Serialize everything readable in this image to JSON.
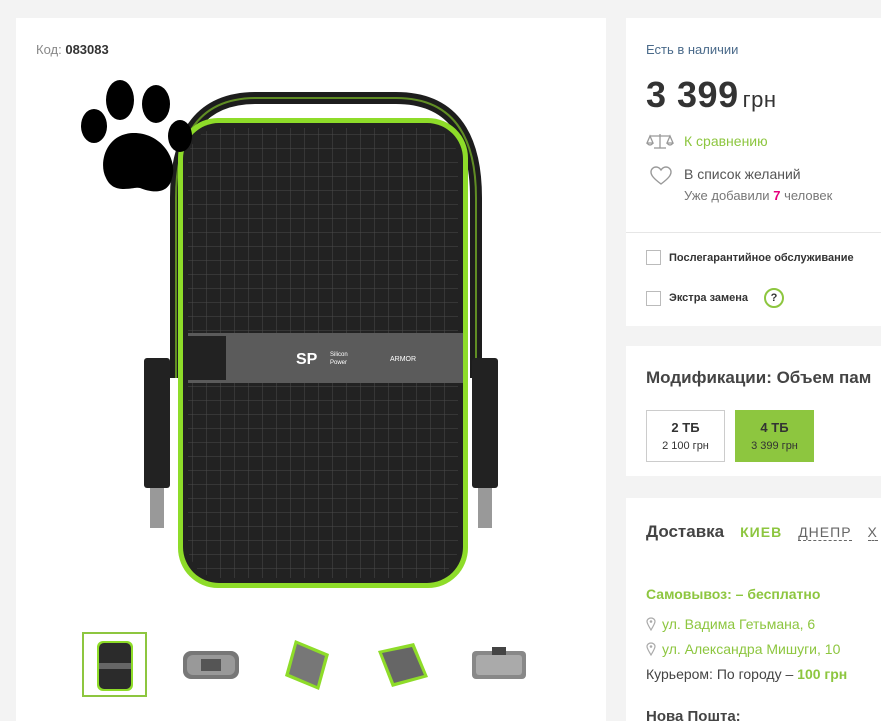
{
  "product": {
    "code_label": "Код:",
    "code_value": "083083"
  },
  "gallery": {
    "thumbnails": [
      "thumb-front",
      "thumb-side",
      "thumb-angle-1",
      "thumb-angle-2",
      "thumb-top"
    ],
    "active_index": 0,
    "logo_text": "SP",
    "logo_sub1": "Silicon",
    "logo_sub2": "Power",
    "model_text": "ARMOR"
  },
  "buy": {
    "stock": "Есть в наличии",
    "price": "3 399",
    "currency": "грн",
    "compare_label": "К сравнению",
    "wishlist_label": "В список желаний",
    "wishlist_sub_prefix": "Уже добавили",
    "wishlist_count": "7",
    "wishlist_sub_suffix": "человек",
    "options": [
      {
        "label": "Послегарантийное обслуживание"
      },
      {
        "label": "Экстра замена",
        "help": "?"
      }
    ]
  },
  "modifications": {
    "title": "Модификации: Объем пам",
    "items": [
      {
        "name": "2 ТБ",
        "price": "2 100 грн",
        "selected": false
      },
      {
        "name": "4 ТБ",
        "price": "3 399 грн",
        "selected": true
      }
    ]
  },
  "delivery": {
    "title": "Доставка",
    "cities": [
      "КИЕВ",
      "ДНЕПР",
      "Х"
    ],
    "pickup_label": "Самовывоз: – бесплатно",
    "addresses": [
      "ул. Вадима Гетьмана, 6",
      "ул. Александра Мишуги, 10"
    ],
    "courier_prefix": "Курьером: По городу –",
    "courier_price": "100",
    "courier_currency": "грн",
    "nova_label": "Нова Пошта:"
  },
  "colors": {
    "accent": "#8dc63f",
    "link_blue": "#4a6a8a",
    "count_pink": "#e6007e"
  }
}
